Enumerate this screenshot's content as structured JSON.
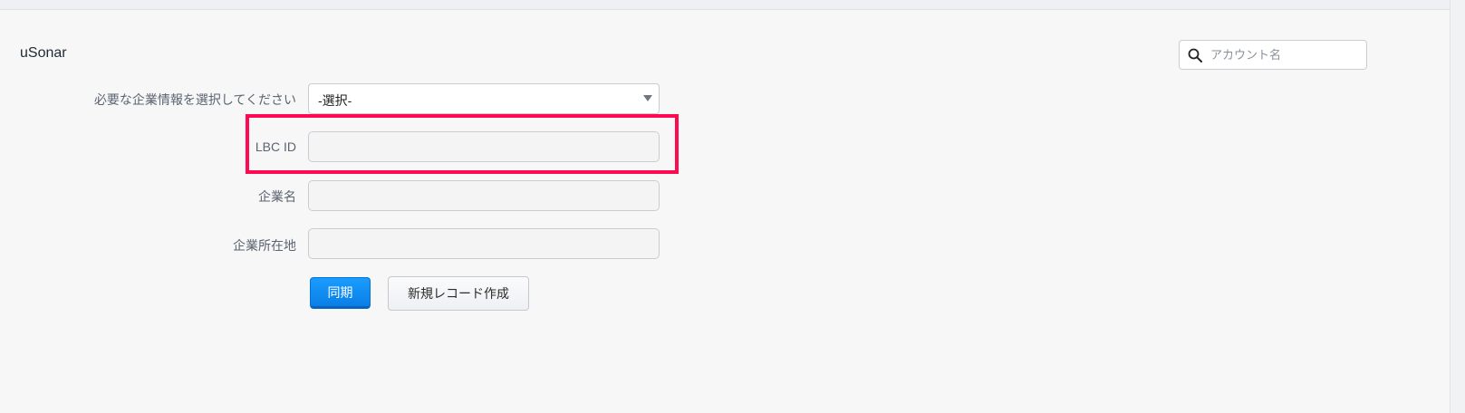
{
  "app": {
    "title": "uSonar"
  },
  "search": {
    "placeholder": "アカウント名",
    "value": "",
    "icon": "search-icon"
  },
  "form": {
    "company_info_select": {
      "label": "必要な企業情報を選択してください",
      "selected": "-選択-",
      "icon": "chevron-down-icon"
    },
    "lbc_id": {
      "label": "LBC ID",
      "value": ""
    },
    "company_name": {
      "label": "企業名",
      "value": ""
    },
    "company_address": {
      "label": "企業所在地",
      "value": ""
    }
  },
  "actions": {
    "sync_label": "同期",
    "create_record_label": "新規レコード作成"
  },
  "colors": {
    "highlight": "#ff0a52",
    "primary_button": "#0a7fe6",
    "background": "#f7f7f8"
  }
}
